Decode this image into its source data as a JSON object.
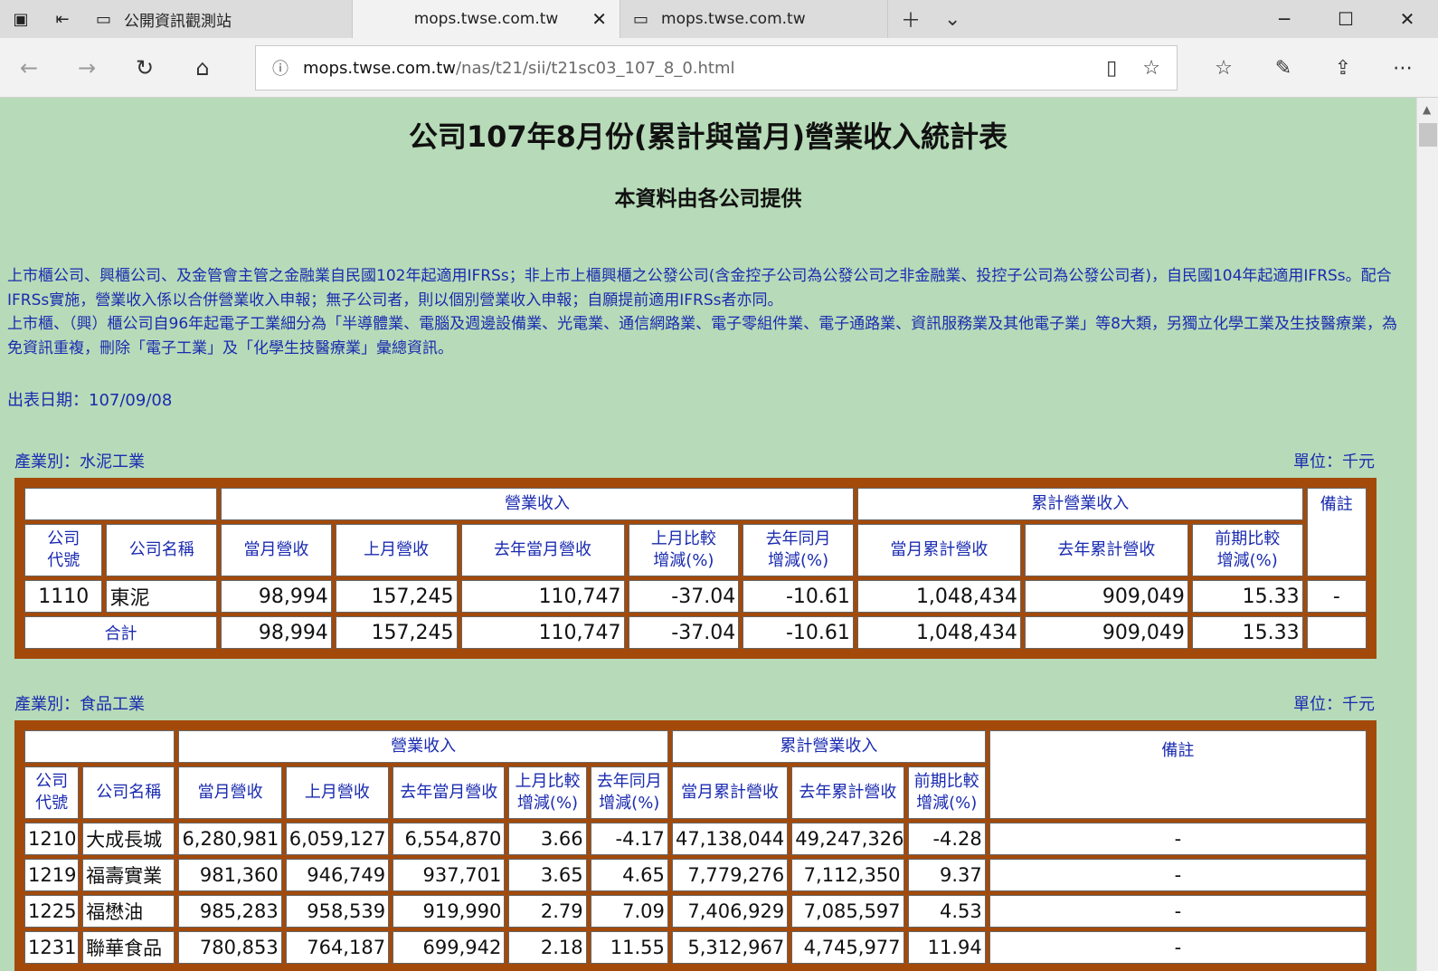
{
  "browser": {
    "tabs": [
      {
        "label": "公開資訊觀測站",
        "active": false
      },
      {
        "label": "mops.twse.com.tw",
        "active": true
      },
      {
        "label": "mops.twse.com.tw",
        "active": false
      }
    ],
    "url_host": "mops.twse.com.tw",
    "url_path": "/nas/t21/sii/t21sc03_107_8_0.html"
  },
  "page": {
    "title": "公司107年8月份(累計與當月)營業收入統計表",
    "subtitle": "本資料由各公司提供",
    "notes": [
      "上市櫃公司、興櫃公司、及金管會主管之金融業自民國102年起適用IFRSs；非上市上櫃興櫃之公發公司(含金控子公司為公發公司之非金融業、投控子公司為公發公司者)，自民國104年起適用IFRSs。配合IFRSs實施，營業收入係以合併營業收入申報；無子公司者，則以個別營業收入申報；自願提前適用IFRSs者亦同。",
      "上市櫃、（興）櫃公司自96年起電子工業細分為「半導體業、電腦及週邊設備業、光電業、通信網路業、電子零組件業、電子通路業、資訊服務業及其他電子業」等8大類，另獨立化學工業及生技醫療業，為免資訊重複，刪除「電子工業」及「化學生技醫療業」彙總資訊。"
    ],
    "publish_date": "出表日期：107/09/08"
  },
  "headers": {
    "revenue_group": "營業收入",
    "cumulative_group": "累計營業收入",
    "code": "公司\n代號",
    "name": "公司名稱",
    "current_month": "當月營收",
    "last_month": "上月營收",
    "last_year_month": "去年當月營收",
    "mom_change": "上月比較\n增減(%)",
    "yoy_change": "去年同月\n增減(%)",
    "cum_current": "當月累計營收",
    "cum_last_year": "去年累計營收",
    "cum_change": "前期比較\n增減(%)",
    "remark": "備註"
  },
  "sections": [
    {
      "industry": "產業別：水泥工業",
      "unit": "單位：千元",
      "rows": [
        {
          "code": "1110",
          "name": "東泥",
          "cur": "98,994",
          "last": "157,245",
          "ly": "110,747",
          "mom": "-37.04",
          "yoy": "-10.61",
          "cum": "1,048,434",
          "cumly": "909,049",
          "cumchg": "15.33",
          "remark": "-"
        }
      ],
      "total": {
        "label": "合計",
        "cur": "98,994",
        "last": "157,245",
        "ly": "110,747",
        "mom": "-37.04",
        "yoy": "-10.61",
        "cum": "1,048,434",
        "cumly": "909,049",
        "cumchg": "15.33",
        "remark": ""
      }
    },
    {
      "industry": "產業別：食品工業",
      "unit": "單位：千元",
      "rows": [
        {
          "code": "1210",
          "name": "大成長城",
          "cur": "6,280,981",
          "last": "6,059,127",
          "ly": "6,554,870",
          "mom": "3.66",
          "yoy": "-4.17",
          "cum": "47,138,044",
          "cumly": "49,247,326",
          "cumchg": "-4.28",
          "remark": "-"
        },
        {
          "code": "1219",
          "name": "福壽實業",
          "cur": "981,360",
          "last": "946,749",
          "ly": "937,701",
          "mom": "3.65",
          "yoy": "4.65",
          "cum": "7,779,276",
          "cumly": "7,112,350",
          "cumchg": "9.37",
          "remark": "-"
        },
        {
          "code": "1225",
          "name": "福懋油",
          "cur": "985,283",
          "last": "958,539",
          "ly": "919,990",
          "mom": "2.79",
          "yoy": "7.09",
          "cum": "7,406,929",
          "cumly": "7,085,597",
          "cumchg": "4.53",
          "remark": "-"
        },
        {
          "code": "1231",
          "name": "聯華食品",
          "cur": "780,853",
          "last": "764,187",
          "ly": "699,942",
          "mom": "2.18",
          "yoy": "11.55",
          "cum": "5,312,967",
          "cumly": "4,745,977",
          "cumchg": "11.94",
          "remark": "-"
        }
      ]
    }
  ]
}
